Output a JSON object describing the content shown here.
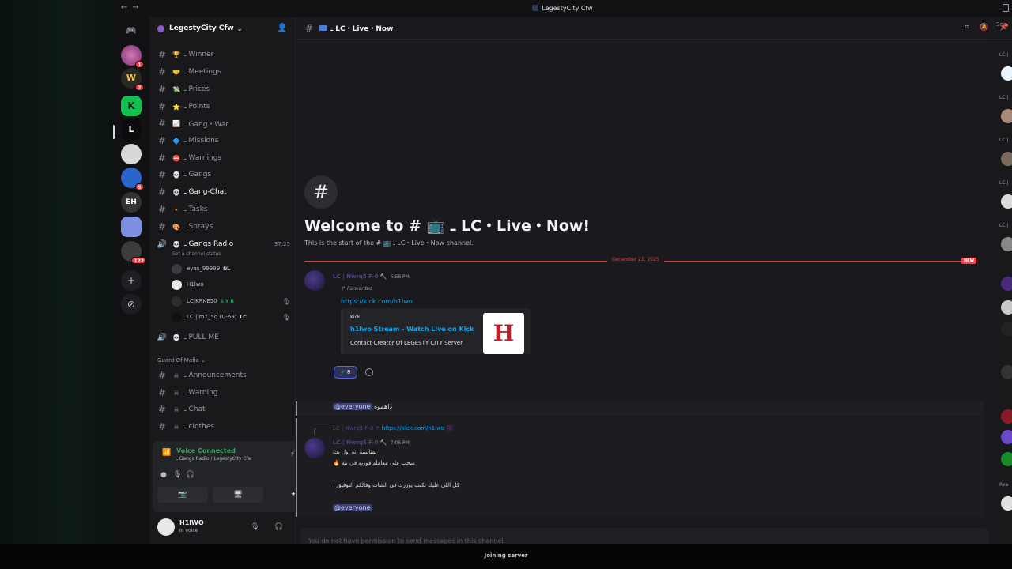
{
  "window": {
    "title": "LegestyCity Cfw",
    "bottom_status": "Joining server"
  },
  "rail": {
    "home_icon": "discord-icon",
    "badges": [
      "1",
      "2",
      "5",
      "122"
    ]
  },
  "server": {
    "name": "LegestyCity Cfw",
    "channels": [
      {
        "name": "ـ Winner",
        "emoji": "🏆",
        "kind": "text"
      },
      {
        "name": "ـ Meetings",
        "emoji": "🤝",
        "kind": "text"
      },
      {
        "name": "ـ Prices",
        "emoji": "💸",
        "kind": "text"
      },
      {
        "name": "ـ Points",
        "emoji": "⭐",
        "kind": "text"
      },
      {
        "name": "ـ Gang・War",
        "emoji": "📈",
        "kind": "text"
      },
      {
        "name": "ـ Missions",
        "emoji": "🔷",
        "kind": "text"
      },
      {
        "name": "ـ Warnings",
        "emoji": "⛔",
        "kind": "text"
      },
      {
        "name": "ـ Gangs",
        "emoji": "💀",
        "kind": "text"
      },
      {
        "name": "ـ Gang-Chat",
        "emoji": "💀",
        "kind": "text",
        "active": true
      },
      {
        "name": "ـ Tasks",
        "emoji": "🔸",
        "kind": "text"
      },
      {
        "name": "ـ Sprays",
        "emoji": "🎨",
        "kind": "text"
      }
    ],
    "voice_channel": {
      "name": "ـ Gangs Radio",
      "timer": "37:25",
      "status_hint": "Set a channel status"
    },
    "voice_users": [
      {
        "name": "eyas_99999",
        "tag": "NL"
      },
      {
        "name": "H1lwo",
        "tag": ""
      },
      {
        "name": "LC|KRKE50",
        "tag": "S Y R"
      },
      {
        "name": "LC | m7_5q (U-69)",
        "tag": "LC"
      }
    ],
    "voice_channel_2": {
      "name": "ـ PULL ME"
    },
    "category": "Guard Of Mafia",
    "category_channels": [
      {
        "name": "ـ Announcements"
      },
      {
        "name": "ـ Warning"
      },
      {
        "name": "ـ Chat"
      },
      {
        "name": "ـ clothes"
      }
    ]
  },
  "voice_panel": {
    "status": "Voice Connected",
    "location": "ـ Gangs Radio / LegestyCity Cfw"
  },
  "user": {
    "name": "H1lWO",
    "status": "In voice"
  },
  "channel": {
    "header_name": "ـ LC・Live・Now",
    "welcome_title": "Welcome to # 📺 ـ LC・Live・Now!",
    "welcome_sub": "This is the start of the # 📺 ـ LC・Live・Now channel.",
    "divider_date": "December 21, 2025",
    "new_tag": "NEW",
    "composer_placeholder": "You do not have permission to send messages in this channel."
  },
  "messages": [
    {
      "author": "LC | Nwrq5 F-0",
      "time": "6:58 PM",
      "forwarded_label": "Forwarded",
      "link": "https://kick.com/h1lwo",
      "embed": {
        "provider": "Kick",
        "title": "h1lwo Stream - Watch Live on Kick",
        "description": "Contact Creator Of LEGESTY CITY Server",
        "thumb_letter": "H"
      },
      "reaction_count": "8",
      "followup_mention": "@everyone",
      "followup_text": "داهموه"
    },
    {
      "reply_author": "LC | Nwrq5 F-0",
      "reply_link": "https://kick.com/h1lwo",
      "author": "LC | Nwrq5 F-0",
      "time": "7:06 PM",
      "lines": [
        "بمناسبة انه اول بث",
        "سحب على معاملة فورية في بثه 🔥",
        "كل اللي عليك تكتب يوزرك في الشات وفالكم التوفيق !"
      ],
      "mention": "@everyone"
    }
  ],
  "members": {
    "categories": [
      "LC |",
      "LC |",
      "LC |",
      "LC |",
      "LC |",
      "Rea"
    ],
    "search_label": "Sea"
  }
}
